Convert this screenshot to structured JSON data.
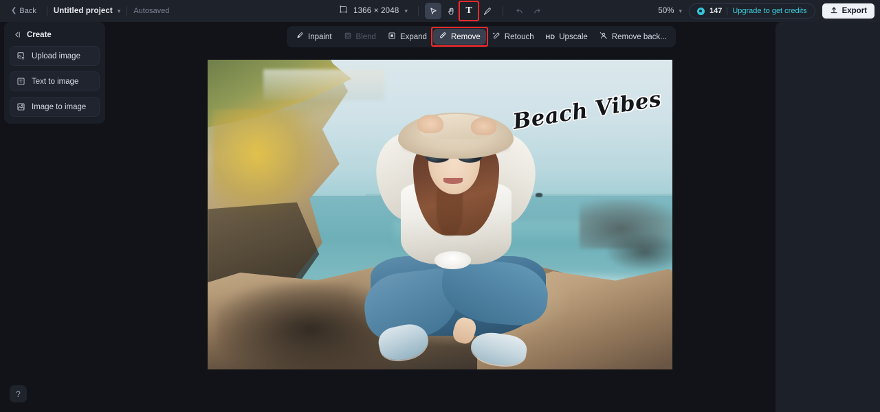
{
  "topbar": {
    "back_label": "Back",
    "project_name": "Untitled project",
    "autosaved_label": "Autosaved",
    "canvas_size": "1366 × 2048",
    "zoom_level": "50%",
    "credits_count": "147",
    "upgrade_label": "Upgrade to get credits",
    "export_label": "Export",
    "tools": [
      {
        "name": "select-tool",
        "glyph": "cursor",
        "state": "active"
      },
      {
        "name": "hand-tool",
        "glyph": "hand",
        "state": "normal"
      },
      {
        "name": "text-tool",
        "glyph": "T",
        "state": "highlighted"
      },
      {
        "name": "brush-tool",
        "glyph": "brush",
        "state": "normal"
      },
      {
        "name": "undo-tool",
        "glyph": "undo",
        "state": "disabled"
      },
      {
        "name": "redo-tool",
        "glyph": "redo",
        "state": "disabled"
      }
    ]
  },
  "sidebar": {
    "title": "Create",
    "items": [
      {
        "label": "Upload image",
        "icon": "upload-image-icon"
      },
      {
        "label": "Text to image",
        "icon": "text-to-image-icon"
      },
      {
        "label": "Image to image",
        "icon": "image-to-image-icon"
      }
    ]
  },
  "subtoolbar": {
    "buttons": [
      {
        "label": "Inpaint",
        "icon": "inpaint-icon",
        "state": "normal"
      },
      {
        "label": "Blend",
        "icon": "blend-icon",
        "state": "disabled"
      },
      {
        "label": "Expand",
        "icon": "expand-icon",
        "state": "normal"
      },
      {
        "label": "Remove",
        "icon": "remove-icon",
        "state": "active-highlighted"
      },
      {
        "label": "Retouch",
        "icon": "retouch-icon",
        "state": "normal"
      },
      {
        "label": "Upscale",
        "icon": "hd-badge",
        "state": "normal"
      },
      {
        "label": "Remove back...",
        "icon": "remove-background-icon",
        "state": "normal"
      }
    ]
  },
  "canvas": {
    "overlay_text": "Beach Vibes",
    "image_description": "Woman in white shirt, sun hat and sunglasses sitting on a coastal rock with ocean behind"
  },
  "help": {
    "label": "?"
  },
  "colors": {
    "accent_cyan": "#3fd0e0",
    "highlight_red": "#ff2a2a",
    "topbar_bg": "#1e222b",
    "canvas_bg": "#111318",
    "panel_bg": "#1c2029"
  }
}
